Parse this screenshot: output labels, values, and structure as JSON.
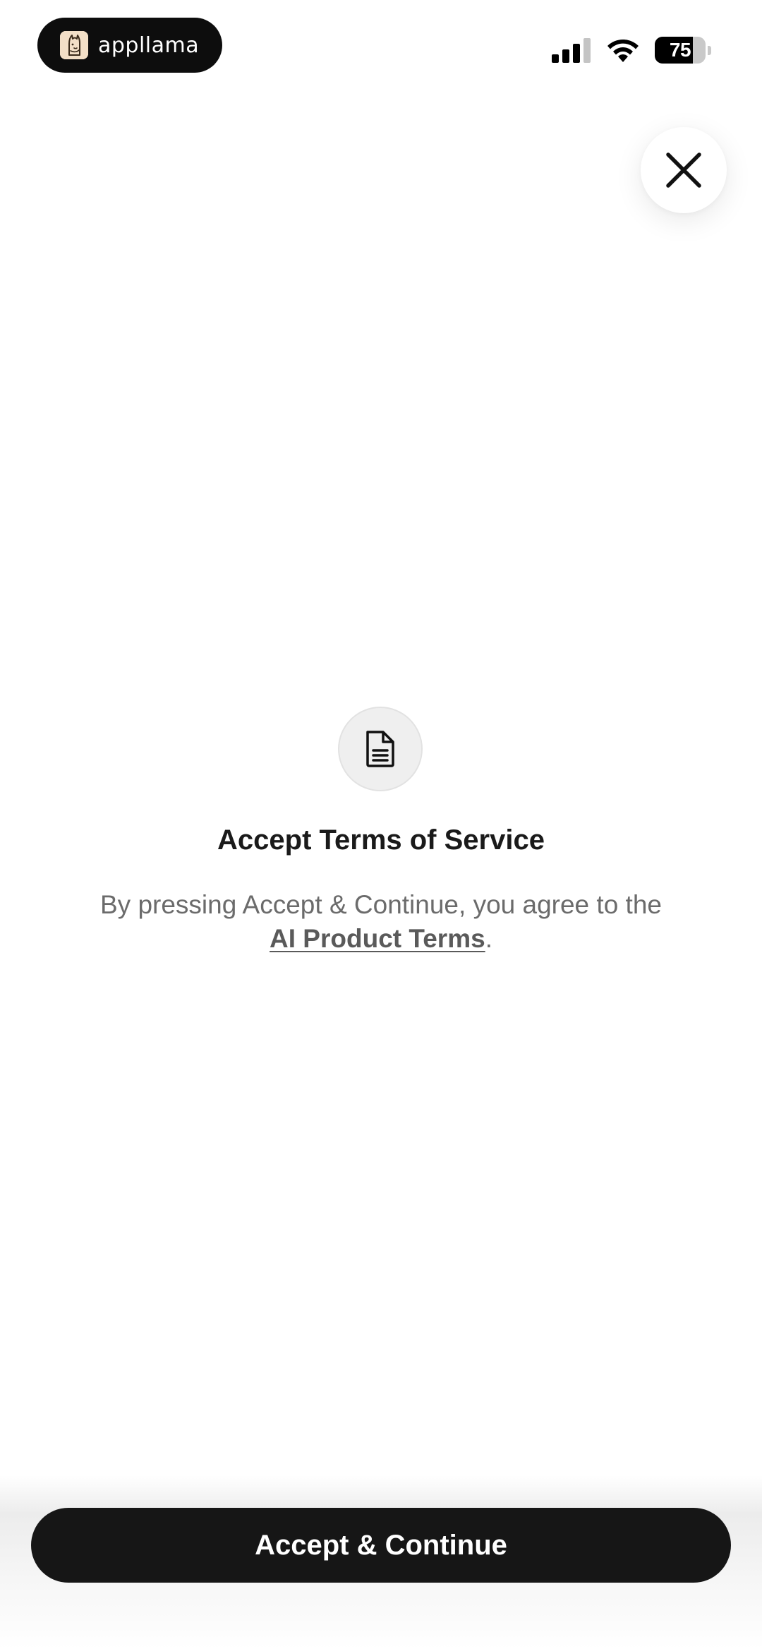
{
  "status_bar": {
    "app_pill_label": "appllama",
    "app_logo_icon": "llama-logo-icon",
    "signal_icon": "cellular-signal-icon",
    "wifi_icon": "wifi-icon",
    "battery_level": "75",
    "battery_fraction": 0.75
  },
  "close": {
    "icon": "close-icon"
  },
  "content": {
    "icon": "document-icon",
    "title": "Accept Terms of Service",
    "body_prefix": "By pressing Accept & Continue, you agree to the ",
    "link_text": "AI Product Terms",
    "body_suffix": "."
  },
  "footer": {
    "accept_label": "Accept & Continue"
  },
  "colors": {
    "background": "#ffffff",
    "button_background": "#161616",
    "button_text": "#ffffff",
    "title_text": "#1a1a1a",
    "body_text": "#6b6b6b",
    "icon_badge": "#efefef"
  }
}
